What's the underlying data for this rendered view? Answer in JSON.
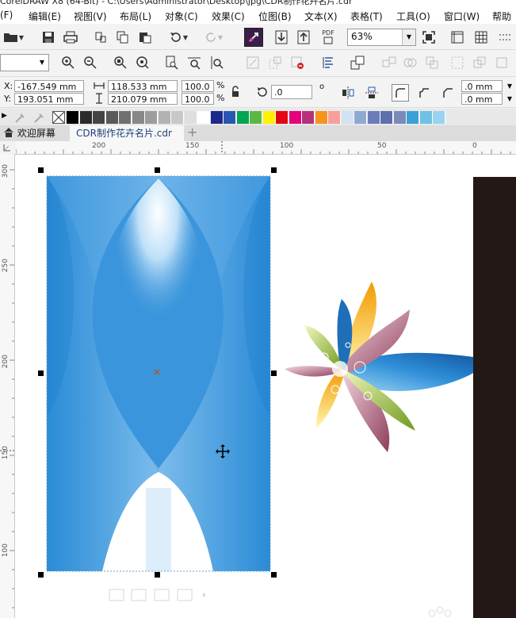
{
  "window": {
    "title": "CorelDRAW X8 (64-Bit) - C:\\Users\\Administrator\\Desktop\\jpg\\CDR制作花卉名片.cdr"
  },
  "menubar": {
    "items": [
      "(F)",
      "编辑(E)",
      "视图(V)",
      "布局(L)",
      "对象(C)",
      "效果(C)",
      "位图(B)",
      "文本(X)",
      "表格(T)",
      "工具(O)",
      "窗口(W)",
      "帮助"
    ]
  },
  "toolbar": {
    "zoom_value": "63%",
    "pdf_label": "PDF"
  },
  "property_bar": {
    "x_label": "X:",
    "x_value": "-167.549 mm",
    "y_label": "Y:",
    "y_value": "193.051 mm",
    "width_value": "118.533 mm",
    "height_value": "210.079 mm",
    "scale_x": "100.0",
    "scale_y": "100.0",
    "percent": "%",
    "rotation": ".0",
    "degree": "o",
    "outline_1": ".0 mm",
    "outline_2": ".0 mm"
  },
  "palette": {
    "colors": [
      "#000000",
      "#2b2b2b",
      "#444444",
      "#5a5a5a",
      "#707070",
      "#888888",
      "#9c9c9c",
      "#b2b2b2",
      "#c8c8c8",
      "#dedede",
      "#ffffff",
      "#1b2a8a",
      "#2a56b0",
      "#00a651",
      "#5ab946",
      "#fff200",
      "#e30613",
      "#e6007e",
      "#b5317c",
      "#f7941d",
      "#f6a09a",
      "#d2e2f2",
      "#8fa9d2",
      "#6b7db8",
      "#5e6fae",
      "#7a8bb8",
      "#3aa0d8",
      "#6ec1e4",
      "#98d3ef"
    ]
  },
  "tabs": {
    "welcome": "欢迎屏幕",
    "document": "CDR制作花卉名片.cdr",
    "add": "+"
  },
  "hruler": {
    "labels": [
      "200",
      "150",
      "100",
      "50",
      "0"
    ]
  },
  "vruler": {
    "labels": [
      "300",
      "250",
      "200",
      "150",
      "100"
    ]
  },
  "colors": {
    "accent_blue": "#2f8fd8",
    "dark_panel": "#231815"
  }
}
